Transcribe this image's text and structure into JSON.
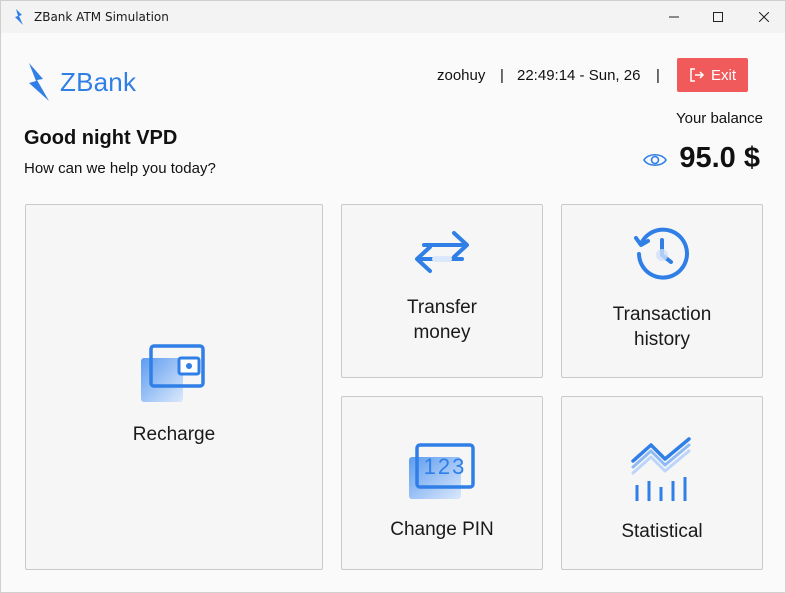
{
  "window": {
    "title": "ZBank ATM Simulation"
  },
  "brand": {
    "name": "ZBank",
    "color": "#2f7fe6"
  },
  "header": {
    "user": "zoohuy",
    "separator": "|",
    "clock": "22:49:14 - Sun, 26",
    "exit_label": "Exit"
  },
  "greeting": {
    "title": "Good night VPD",
    "subtitle": "How can we help you today?"
  },
  "balance": {
    "label": "Your balance",
    "value": "95.0 $"
  },
  "cards": {
    "recharge": {
      "label": "Recharge",
      "icon": "wallet-icon"
    },
    "transfer": {
      "line1": "Transfer",
      "line2": "money",
      "icon": "transfer-arrows-icon"
    },
    "history": {
      "line1": "Transaction",
      "line2": "history",
      "icon": "history-clock-icon"
    },
    "pin": {
      "label": "Change PIN",
      "icon": "pin-123-icon",
      "icon_text": "123"
    },
    "stat": {
      "label": "Statistical",
      "icon": "chart-icon"
    }
  },
  "colors": {
    "accent": "#2f7fe6",
    "exit": "#f05a5a"
  }
}
